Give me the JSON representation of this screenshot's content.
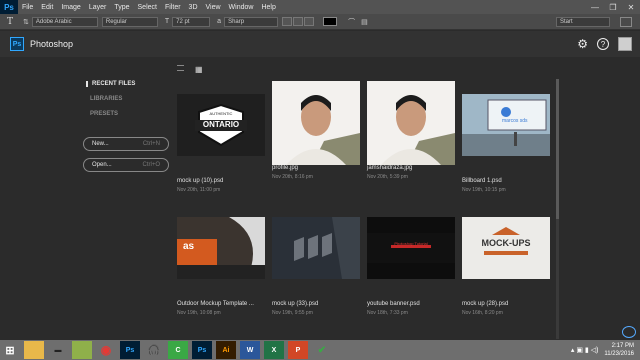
{
  "menubar": {
    "logo": "Ps",
    "items": [
      "File",
      "Edit",
      "Image",
      "Layer",
      "Type",
      "Select",
      "Filter",
      "3D",
      "View",
      "Window",
      "Help"
    ],
    "controls": [
      "—",
      "❐",
      "✕"
    ]
  },
  "options": {
    "tool_glyph": "T",
    "font_family": "Adobe Arabic",
    "font_style": "Regular",
    "font_size": "72 pt",
    "aa": "a",
    "antialias": "Sharp",
    "text_color": "#000000",
    "workspace": "Start"
  },
  "start": {
    "badge": "Ps",
    "title": "Photoshop",
    "help": "?"
  },
  "nav": {
    "recent": "RECENT FILES",
    "libraries": "LIBRARIES",
    "presets": "PRESETS",
    "new_label": "New...",
    "new_shortcut": "Ctrl+N",
    "open_label": "Open...",
    "open_shortcut": "Ctrl+O"
  },
  "files": [
    {
      "name": "mock up (10).psd",
      "date": "Nov 20th, 11:00 pm",
      "thumb_text": "ONTARIO",
      "thumb_sub": "AUTHENTIC"
    },
    {
      "name": "profile.jpg",
      "date": "Nov 20th, 8:16 pm",
      "thumb_text": "",
      "thumb_sub": ""
    },
    {
      "name": "jamshaidraza.jpg",
      "date": "Nov 20th, 5:39 pm",
      "thumb_text": "",
      "thumb_sub": ""
    },
    {
      "name": "Billboard 1.psd",
      "date": "Nov 19th, 10:15 pm",
      "thumb_text": "marcos sds",
      "thumb_sub": ""
    },
    {
      "name": "Outdoor Mockup Template ...",
      "date": "Nov 19th, 10:08 pm",
      "thumb_text": "as",
      "thumb_sub": ""
    },
    {
      "name": "mock up (33).psd",
      "date": "Nov 19th, 9:55 pm",
      "thumb_text": "",
      "thumb_sub": ""
    },
    {
      "name": "youtube banner.psd",
      "date": "Nov 18th, 7:33 pm",
      "thumb_text": "Photoshop Tutorial",
      "thumb_sub": ""
    },
    {
      "name": "mock up (28).psd",
      "date": "Nov 16th, 8:20 pm",
      "thumb_text": "MOCK-UPS",
      "thumb_sub": ""
    }
  ],
  "taskbar": {
    "apps": [
      "⊞",
      "📁",
      "▬",
      "🖼",
      "◉",
      "Ps",
      "🎧",
      "C",
      "Ps",
      "Ai",
      "W",
      "X",
      "P",
      "✔"
    ],
    "time": "2:17 PM",
    "date": "11/23/2016"
  }
}
